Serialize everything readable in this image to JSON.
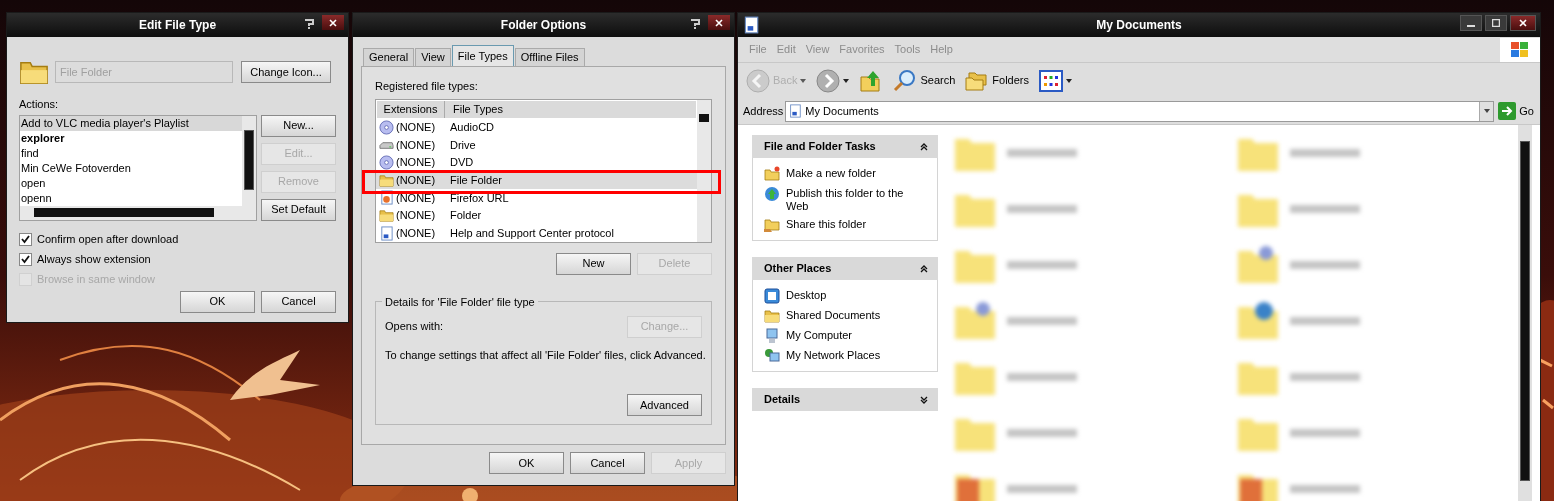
{
  "edit_file_type": {
    "title": "Edit File Type",
    "type_field": {
      "value": "File Folder",
      "disabled": true
    },
    "change_icon": "Change Icon...",
    "actions_label": "Actions:",
    "actions": [
      {
        "label": "Add to VLC media player's Playlist",
        "selected": true,
        "default": false
      },
      {
        "label": "explorer",
        "selected": false,
        "default": true
      },
      {
        "label": "find",
        "selected": false,
        "default": false
      },
      {
        "label": "Min CeWe Fotoverden",
        "selected": false,
        "default": false
      },
      {
        "label": "open",
        "selected": false,
        "default": false
      },
      {
        "label": "openn",
        "selected": false,
        "default": false
      }
    ],
    "action_buttons": [
      {
        "label": "New...",
        "disabled": false
      },
      {
        "label": "Edit...",
        "disabled": true
      },
      {
        "label": "Remove",
        "disabled": true
      },
      {
        "label": "Set Default",
        "disabled": false
      }
    ],
    "options": [
      {
        "label": "Confirm open after download",
        "checked": true,
        "disabled": false
      },
      {
        "label": "Always show extension",
        "checked": true,
        "disabled": false
      },
      {
        "label": "Browse in same window",
        "checked": false,
        "disabled": true
      }
    ],
    "buttons": [
      {
        "label": "OK",
        "disabled": false
      },
      {
        "label": "Cancel",
        "disabled": false
      }
    ]
  },
  "folder_options": {
    "title": "Folder Options",
    "tabs": [
      {
        "label": "General",
        "selected": false
      },
      {
        "label": "View",
        "selected": false
      },
      {
        "label": "File Types",
        "selected": true
      },
      {
        "label": "Offline Files",
        "selected": false
      }
    ],
    "list_label": "Registered file types:",
    "columns": [
      "Extensions",
      "File Types"
    ],
    "file_types": [
      {
        "extension": "(NONE)",
        "type": "AudioCD",
        "kind": "cd",
        "selected": false,
        "framed": false
      },
      {
        "extension": "(NONE)",
        "type": "Drive",
        "kind": "drive",
        "selected": false,
        "framed": false
      },
      {
        "extension": "(NONE)",
        "type": "DVD",
        "kind": "cd",
        "selected": false,
        "framed": false
      },
      {
        "extension": "(NONE)",
        "type": "File Folder",
        "kind": "folder",
        "selected": true,
        "framed": true
      },
      {
        "extension": "(NONE)",
        "type": "Firefox URL",
        "kind": "web",
        "selected": false,
        "framed": false
      },
      {
        "extension": "(NONE)",
        "type": "Folder",
        "kind": "folder",
        "selected": false,
        "framed": false
      },
      {
        "extension": "(NONE)",
        "type": "Help and Support Center protocol",
        "kind": "doc",
        "selected": false,
        "framed": false
      }
    ],
    "list_buttons": [
      {
        "label": "New",
        "disabled": false
      },
      {
        "label": "Delete",
        "disabled": true
      }
    ],
    "details": {
      "title": "Details for 'File Folder' file type",
      "opens_with_label": "Opens with:",
      "change_button": {
        "label": "Change...",
        "disabled": true
      },
      "note": "To change settings that affect all 'File Folder' files, click Advanced.",
      "advanced_button": {
        "label": "Advanced",
        "disabled": false
      }
    },
    "buttons": [
      {
        "label": "OK",
        "disabled": false
      },
      {
        "label": "Cancel",
        "disabled": false
      },
      {
        "label": "Apply",
        "disabled": true
      }
    ]
  },
  "explorer": {
    "title": "My Documents",
    "menu": [
      "File",
      "Edit",
      "View",
      "Favorites",
      "Tools",
      "Help"
    ],
    "toolbar": [
      {
        "label": "Back",
        "kind": "back",
        "disabled": true,
        "dropdown": true
      },
      {
        "kind": "forward",
        "disabled": false,
        "dropdown": true
      },
      {
        "kind": "up",
        "disabled": false,
        "dropdown": false
      },
      {
        "label": "Search",
        "kind": "search",
        "disabled": false,
        "dropdown": false
      },
      {
        "label": "Folders",
        "kind": "folders",
        "disabled": false,
        "dropdown": false
      },
      {
        "kind": "views",
        "disabled": false,
        "dropdown": true
      }
    ],
    "address": {
      "label": "Address",
      "value": "My Documents",
      "go": "Go"
    },
    "panes": [
      {
        "title": "File and Folder Tasks",
        "expanded": true,
        "items": [
          {
            "label": "Make a new folder",
            "kind": "new-folder"
          },
          {
            "label": "Publish this folder to the Web",
            "kind": "globe"
          },
          {
            "label": "Share this folder",
            "kind": "share"
          }
        ]
      },
      {
        "title": "Other Places",
        "expanded": true,
        "items": [
          {
            "label": "Desktop",
            "kind": "desktop"
          },
          {
            "label": "Shared Documents",
            "kind": "folder"
          },
          {
            "label": "My Computer",
            "kind": "computer"
          },
          {
            "label": "My Network Places",
            "kind": "network"
          }
        ]
      },
      {
        "title": "Details",
        "expanded": false
      }
    ]
  }
}
